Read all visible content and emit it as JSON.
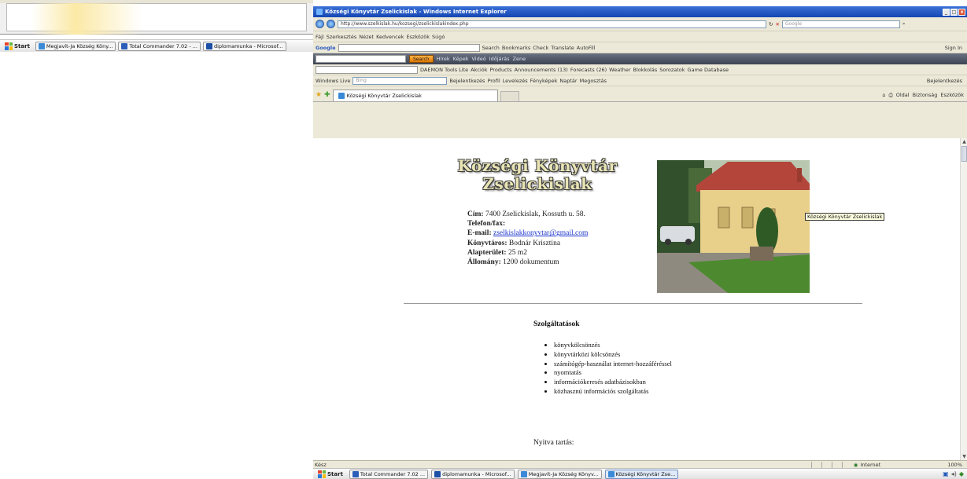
{
  "background": {
    "taskbar": {
      "start_label": "Start",
      "buttons": [
        "Megjavít-Ja Község Köny...",
        "Total Commander 7.02 - ...",
        "diplomamunka - Microsof..."
      ]
    }
  },
  "browser": {
    "title": "Községi Könyvtár Zselickislak - Windows Internet Explorer",
    "address": "http://www.szelkislak.hu/kozsegi/zselickislakindex.php",
    "search_placeholder": "Google",
    "menu": [
      "Fájl",
      "Szerkesztés",
      "Nézet",
      "Kedvencek",
      "Eszközök",
      "Súgó"
    ],
    "google_bar": {
      "label": "Google",
      "items": [
        "Search",
        "Bookmarks",
        "Check",
        "Translate",
        "AutoFill"
      ],
      "signin": "Sign In"
    },
    "dark_bar": {
      "search_button": "Search",
      "items": [
        "Hírek",
        "Képek",
        "Videó",
        "Időjárás",
        "Zene"
      ]
    },
    "links_bar": {
      "items": [
        "DAEMON Tools Lite",
        "Akciók",
        "Products",
        "Announcements (13)",
        "Forecasts (26)",
        "Weather",
        "Blokkolás",
        "Sorozatok",
        "Game Database"
      ]
    },
    "live_bar": {
      "label": "Windows Live",
      "search_placeholder": "Bing",
      "items": [
        "Bejelentkezés",
        "Profil",
        "Levelezés",
        "Fényképek",
        "Naptár",
        "Megosztás"
      ],
      "signin": "Bejelentkezés"
    },
    "tab_title": "Községi Könyvtár Zselickislak",
    "tab_tools": [
      "Oldal",
      "Biztonság",
      "Eszközök"
    ],
    "status_left": "Kész",
    "status_zone": "Internet",
    "zoom": "100%"
  },
  "page": {
    "title_line1": "Községi Könyvtár",
    "title_line2": "Zselickislak",
    "info": {
      "address_label": "Cím:",
      "address_value": "7400 Zselickislak, Kossuth u. 58.",
      "phone_label": "Telefon/fax:",
      "email_label": "E-mail:",
      "email_value": "zselkislakkonyvtar@gmail.com",
      "librarian_label": "Könyvtáros:",
      "librarian_value": "Bodnár Krisztina",
      "area_label": "Alapterület:",
      "area_value": "25 m2",
      "stock_label": "Állomány:",
      "stock_value": "1200 dokumentum"
    },
    "photo_tooltip": "Községi Könyvtár Zselickislak",
    "services_title": "Szolgáltatások",
    "services": [
      "könyvkölcsönzés",
      "könyvtárközi kölcsönzés",
      "számítógép-használat internet-hozzáféréssel",
      "nyomtatás",
      "információkeresés adatbázisokban",
      "közhasznú információs szolgáltatás"
    ],
    "hours_title": "Nyitva tartás:"
  },
  "taskbar": {
    "start_label": "Start",
    "buttons": [
      "Total Commander 7.02 ...",
      "diplomamunka - Microsof...",
      "Megjavít-Ja Község Könyv...",
      "Községi Könyvtár Zse..."
    ]
  },
  "colors": {
    "title_bar": "#1446b3",
    "link": "#1a33cc",
    "tooltip_bg": "#ffffe1"
  }
}
